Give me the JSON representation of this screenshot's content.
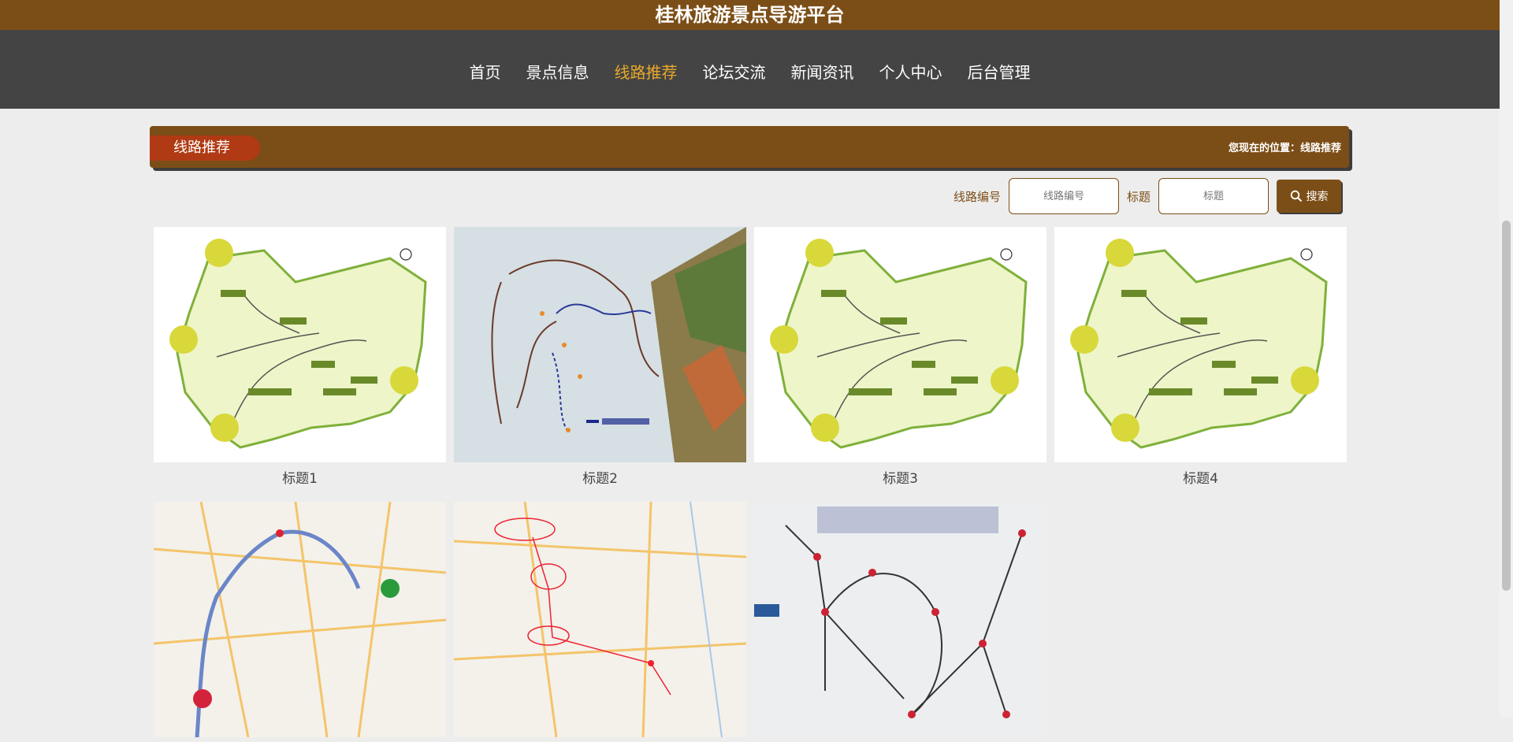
{
  "header": {
    "title": "桂林旅游景点导游平台"
  },
  "nav": {
    "items": [
      {
        "label": "首页"
      },
      {
        "label": "景点信息"
      },
      {
        "label": "线路推荐",
        "active": true
      },
      {
        "label": "论坛交流"
      },
      {
        "label": "新闻资讯"
      },
      {
        "label": "个人中心"
      },
      {
        "label": "后台管理"
      }
    ]
  },
  "banner": {
    "title": "线路推荐",
    "location": "您现在的位置：线路推荐"
  },
  "search": {
    "route_label": "线路编号",
    "route_placeholder": "线路编号",
    "title_label": "标题",
    "title_placeholder": "标题",
    "button_label": "搜索",
    "button_icon": "search-icon"
  },
  "cards": [
    {
      "title": "标题1"
    },
    {
      "title": "标题2"
    },
    {
      "title": "标题3"
    },
    {
      "title": "标题4"
    },
    {
      "title": ""
    },
    {
      "title": ""
    },
    {
      "title": ""
    }
  ],
  "colors": {
    "brand_brown": "#7c4e17",
    "nav_bg": "#444444",
    "active_nav": "#e9a92a",
    "banner_tab": "#b03a13"
  }
}
